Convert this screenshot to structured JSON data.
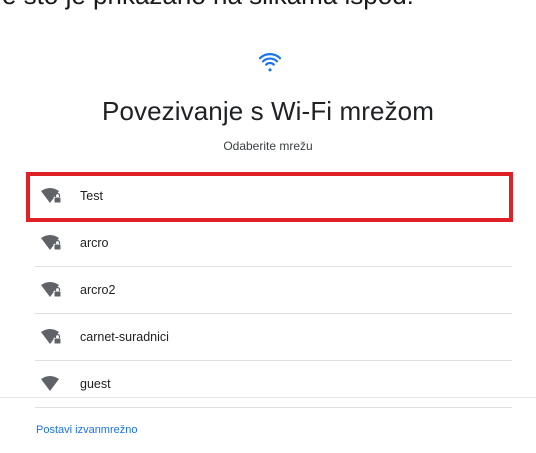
{
  "partial_heading": "e što je prikazano na slikama ispod:",
  "header": {
    "title": "Povezivanje s Wi-Fi mrežom",
    "subtitle": "Odaberite mrežu"
  },
  "networks": [
    {
      "name": "Test",
      "secured": true,
      "highlighted": true
    },
    {
      "name": "arcro",
      "secured": true
    },
    {
      "name": "arcro2",
      "secured": true
    },
    {
      "name": "carnet-suradnici",
      "secured": true
    },
    {
      "name": "guest",
      "secured": false
    }
  ],
  "footer": {
    "offline_link": "Postavi izvanmrežno"
  },
  "colors": {
    "accent": "#1a73e8",
    "highlight_border": "#e02027",
    "wifi_icon": "#5f6368"
  }
}
